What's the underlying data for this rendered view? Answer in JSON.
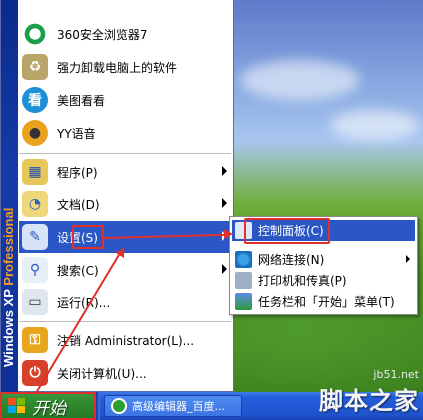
{
  "start_menu": {
    "brand_strip": {
      "text": "Windows XP",
      "edition": "Professional"
    },
    "pinned": [
      {
        "label": "360安全浏览器7",
        "icon": "ie-360-browser-icon"
      },
      {
        "label": "强力卸载电脑上的软件",
        "icon": "recycle-uninstall-icon"
      },
      {
        "label": "美图看看",
        "icon": "meitu-viewer-icon"
      },
      {
        "label": "YY语音",
        "icon": "yy-voice-icon"
      }
    ],
    "items": [
      {
        "label": "程序(P)",
        "icon": "programs-icon",
        "has_submenu": true
      },
      {
        "label": "文档(D)",
        "icon": "documents-icon",
        "has_submenu": true
      },
      {
        "label": "设置(S)",
        "icon": "settings-icon",
        "has_submenu": true,
        "selected": true
      },
      {
        "label": "搜索(C)",
        "icon": "search-icon",
        "has_submenu": true
      },
      {
        "label": "运行(R)...",
        "icon": "run-icon",
        "has_submenu": false
      }
    ],
    "bottom": [
      {
        "label": "注销 Administrator(L)...",
        "icon": "logoff-icon"
      },
      {
        "label": "关闭计算机(U)...",
        "icon": "power-icon"
      }
    ]
  },
  "settings_submenu": {
    "items": [
      {
        "label": "控制面板(C)",
        "icon": "control-panel-icon",
        "selected": true,
        "has_submenu": false
      },
      {
        "label": "网络连接(N)",
        "icon": "network-icon",
        "has_submenu": true
      },
      {
        "label": "打印机和传真(P)",
        "icon": "printer-icon",
        "has_submenu": false
      },
      {
        "label": "任务栏和「开始」菜单(T)",
        "icon": "taskbar-icon",
        "has_submenu": false
      }
    ]
  },
  "taskbar": {
    "start_label": "开始",
    "task_button_label": "高级编辑器_百度..."
  },
  "watermark": {
    "site": "jb51.net",
    "brand": "脚本之家"
  },
  "colors": {
    "selection": "#2a56c6",
    "highlight_box": "#e0302c",
    "start_button": "#2f8a2f",
    "taskbar": "#245edb"
  }
}
